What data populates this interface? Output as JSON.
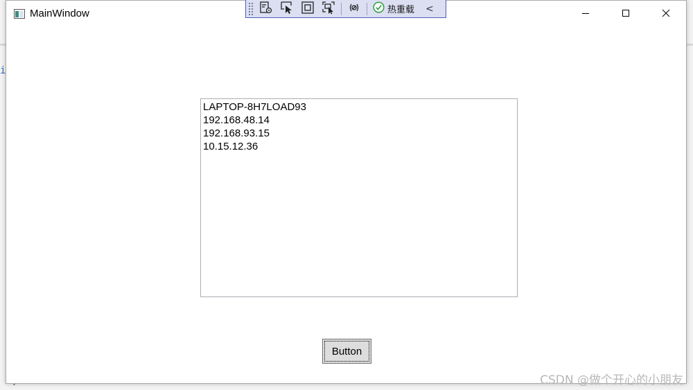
{
  "window": {
    "title": "MainWindow"
  },
  "dev_toolbar": {
    "tools": [
      "live-visual-tree-icon",
      "select-element-icon",
      "display-adorner-icon",
      "track-focus-icon",
      "binding-failures-icon"
    ],
    "hot_reload_label": "热重载",
    "collapse_glyph": "<"
  },
  "background": {
    "glyph": "i",
    "glyph2": "y"
  },
  "listbox": {
    "items": [
      "LAPTOP-8H7LOAD93",
      "192.168.48.14",
      "192.168.93.15",
      "10.15.12.36"
    ]
  },
  "button": {
    "label": "Button"
  },
  "watermark": "CSDN @做个开心的小朋友",
  "colors": {
    "devbar_bg": "#dcdff2",
    "devbar_border": "#4a5cb8",
    "hot_reload_check": "#2e9e3e",
    "button_bg": "#dddddd"
  }
}
